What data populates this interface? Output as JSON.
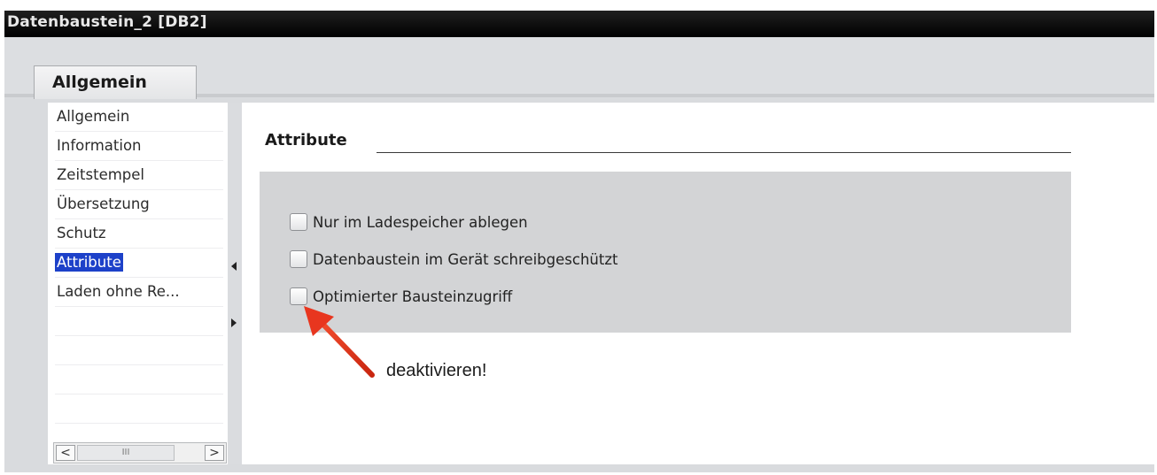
{
  "window": {
    "title": "Datenbaustein_2 [DB2]"
  },
  "tabs": [
    {
      "label": "Allgemein"
    }
  ],
  "sidebar": {
    "items": [
      {
        "label": "Allgemein",
        "selected": false
      },
      {
        "label": "Information",
        "selected": false
      },
      {
        "label": "Zeitstempel",
        "selected": false
      },
      {
        "label": "Übersetzung",
        "selected": false
      },
      {
        "label": "Schutz",
        "selected": false
      },
      {
        "label": "Attribute",
        "selected": true
      },
      {
        "label": "Laden ohne Re...",
        "selected": false
      }
    ],
    "scrollbar": {
      "left": "<",
      "thumb": "III",
      "right": ">"
    }
  },
  "section": {
    "title": "Attribute"
  },
  "checkboxes": [
    {
      "label": "Nur im Ladespeicher ablegen",
      "checked": false
    },
    {
      "label": "Datenbaustein im Gerät schreibgeschützt",
      "checked": false
    },
    {
      "label": "Optimierter Bausteinzugriff",
      "checked": false
    }
  ],
  "annotation": {
    "text": "deaktivieren!",
    "color": "#e8361f"
  },
  "colors": {
    "selection": "#1d41c9",
    "titlebar": "#000000",
    "panel": "#d3d4d6"
  }
}
